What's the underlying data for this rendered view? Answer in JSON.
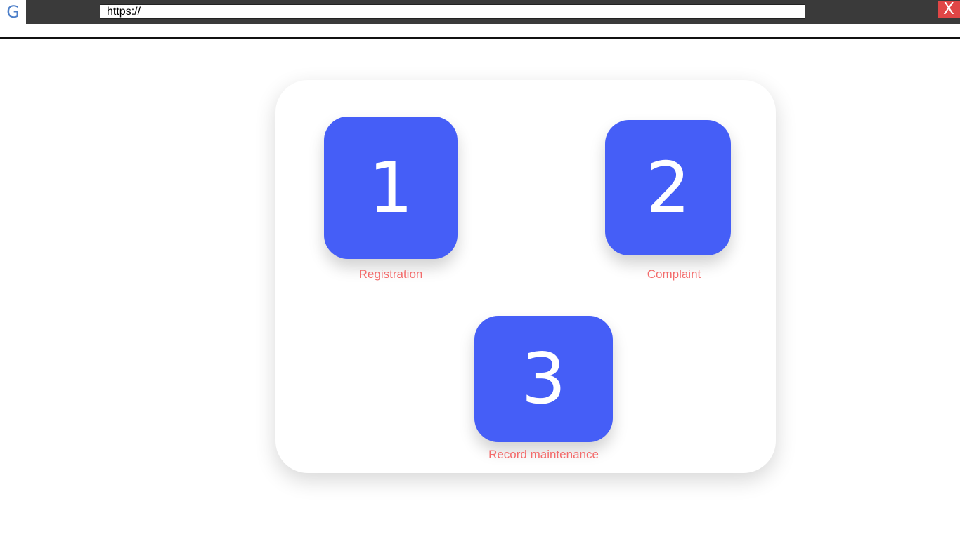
{
  "browser": {
    "logo_text": "G",
    "url_value": "https://",
    "close_label": "X"
  },
  "menu": {
    "items": [
      {
        "number": "1",
        "label": "Registration"
      },
      {
        "number": "2",
        "label": "Complaint"
      },
      {
        "number": "3",
        "label": "Record maintenance"
      }
    ]
  },
  "colors": {
    "tile": "#455ef7",
    "label": "#f36b6b",
    "close": "#e04646",
    "topbar": "#3a3a3a"
  }
}
